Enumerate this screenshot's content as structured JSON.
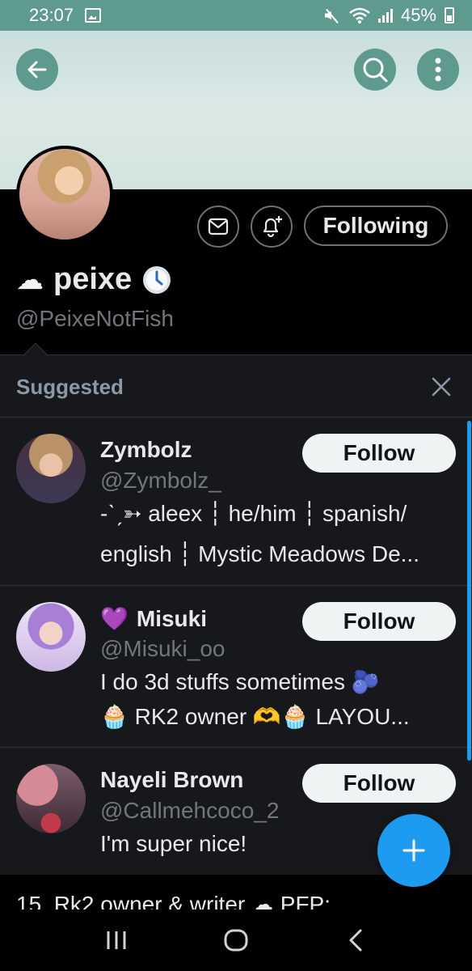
{
  "status_bar": {
    "time": "23:07",
    "battery": "45%",
    "icons": [
      "gallery-icon",
      "mute-icon",
      "wifi-icon",
      "signal-icon",
      "battery-icon"
    ]
  },
  "header": {
    "back_icon": "arrow-left-icon",
    "search_icon": "search-icon",
    "more_icon": "more-vertical-icon"
  },
  "profile": {
    "name_emoji": "☁",
    "display_name": "peixe",
    "name_badge": "🕖",
    "handle": "@PeixeNotFish",
    "message_icon": "envelope-icon",
    "notify_icon": "bell-plus-icon",
    "following_label": "Following"
  },
  "suggested": {
    "title": "Suggested",
    "close_icon": "close-icon",
    "items": [
      {
        "name": "Zymbolz",
        "handle": "@Zymbolz_",
        "bio_line1": "-ˋˏ➳ aleex ┆ he/him ┆ spanish/",
        "bio_line2": "english ┆ Mystic Meadows De...",
        "follow_label": "Follow"
      },
      {
        "name_emoji": "💜",
        "name": "Misuki",
        "handle": "@Misuki_oo",
        "bio_line1": "I do 3d stuffs sometimes 🫐",
        "bio_line2": "🧁 RK2 owner 🫶🧁 LAYOU...",
        "follow_label": "Follow"
      },
      {
        "name": "Nayeli Brown",
        "handle": "@Callmehcoco_2",
        "bio_line1": "I'm super nice!",
        "follow_label": "Follow"
      }
    ]
  },
  "bottom_partial_text": "15. Rk2 owner & writer ☁ PFP:",
  "fab_icon": "plus-icon",
  "nav": {
    "recent_icon": "recent-apps-icon",
    "home_icon": "home-icon",
    "back_icon": "nav-back-icon"
  },
  "colors": {
    "accent": "#1d9bf0",
    "status_bar": "#5f9a8f",
    "panel_bg": "#16181c",
    "muted_text": "#71767b"
  }
}
